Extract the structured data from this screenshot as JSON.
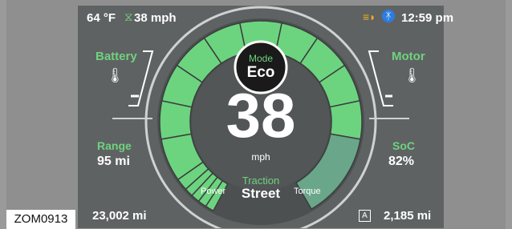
{
  "reference_id": "ZOM0913",
  "status_bar": {
    "temperature": "64 °F",
    "speed_limit": "38 mph",
    "time": "12:59 pm",
    "icons": [
      "speed-limit-icon",
      "adaptive-headlamp-icon",
      "bluetooth-icon"
    ]
  },
  "left_panel": {
    "battery_label": "Battery",
    "battery_icon": "thermometer-icon",
    "range_label": "Range",
    "range_value": "95 mi",
    "odometer": "23,002 mi"
  },
  "right_panel": {
    "motor_label": "Motor",
    "motor_icon": "thermometer-icon",
    "soc_label": "SoC",
    "soc_value": "82%",
    "trip_badge": "A",
    "trip_value": "2,185 mi"
  },
  "center": {
    "mode_label": "Mode",
    "mode_value": "Eco",
    "speed": "38",
    "speed_unit": "mph",
    "traction_label": "Traction",
    "traction_value": "Street",
    "power_label": "Power",
    "torque_label": "Torque"
  },
  "colors": {
    "accent_green": "#6fd27e",
    "panel_bg": "#5f6263",
    "gauge_dark": "#4d5051",
    "text": "#ffffff"
  }
}
